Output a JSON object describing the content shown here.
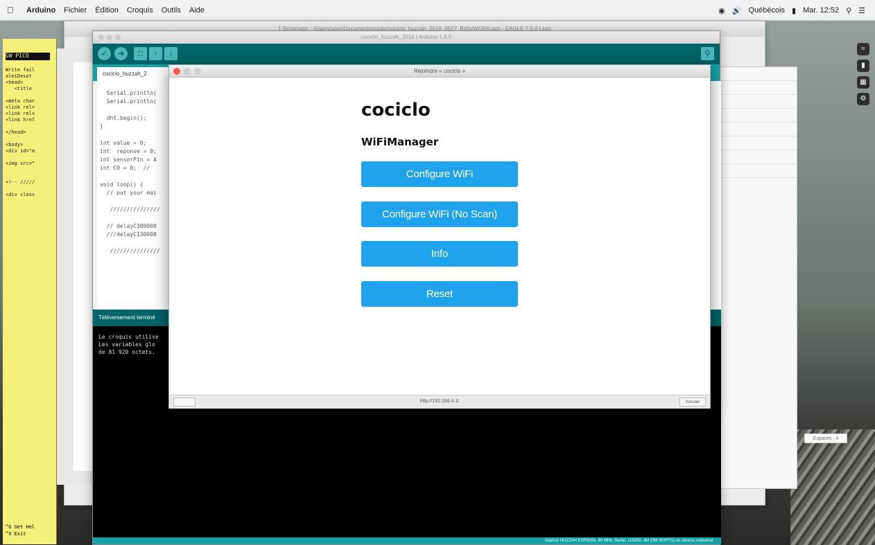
{
  "menubar": {
    "apple": "",
    "items": [
      "Arduino",
      "Fichier",
      "Édition",
      "Croquis",
      "Outils",
      "Aide"
    ],
    "status_text": "Mar. 12:52",
    "battery_label": "Québécois"
  },
  "bg_window": {
    "title": "1 Schematic - /Users/user/Documents/eagle/cociclo_huzzah_2016_0527_BAN/WORK.sch - EAGLE 7.5.0 Light"
  },
  "ide": {
    "title": "cociclo_huzzah_2016 | Arduino 1.6.5",
    "tab": "cociclo_huzzah_2",
    "code_lines": [
      "  Serial.println(",
      "  Serial.println(",
      "",
      "  dht.begin();",
      "}",
      "",
      "int value = 0;",
      "int  reponse = 0;",
      "int sensorPin = A",
      "int CO = 0;  //",
      "",
      "void loop() {",
      "  // put your mai",
      "",
      "   ///////////////",
      "",
      "  // delayC300000",
      "  ///delayC130000",
      "",
      "   ///////////////"
    ],
    "status": "Téléversement terminé",
    "console_lines": [
      "Le croquis utilise",
      "Les variables glo",
      "de 81 920 octets."
    ],
    "footer": "Adafruit HUZZAH ESP8266, 80 MHz, Serial, 115200, 4M (3M SPIFFS) on /dev/cu.usbserial"
  },
  "nano": {
    "header": "GW PICO",
    "lines": [
      "Write fail",
      "aleiDesot",
      "<head>",
      "   <title",
      "",
      "<meta char",
      "<link rel=",
      "<link rel=",
      "<link href",
      "",
      "</head>",
      "",
      "<body>",
      "<div id=\"m",
      "",
      "<img src=\"",
      "",
      "",
      "<!-- /////",
      "",
      "<div class"
    ],
    "footer": [
      "^G Get Hel",
      "^X Exit"
    ]
  },
  "portal": {
    "title": "Rejoindre « cociclo »",
    "heading": "cociclo",
    "subheading": "WiFiManager",
    "buttons": [
      "Configure WiFi",
      "Configure WiFi (No Scan)",
      "Info",
      "Reset"
    ],
    "url": "http://192.168.4.1/",
    "cancel": "Annuler"
  },
  "spaces_label": "Espaces : 4",
  "colors": {
    "button": "#1fa3ec",
    "arduino_teal": "#17a1a5",
    "arduino_dark": "#006468",
    "nano_yellow": "#f5ef7c"
  }
}
